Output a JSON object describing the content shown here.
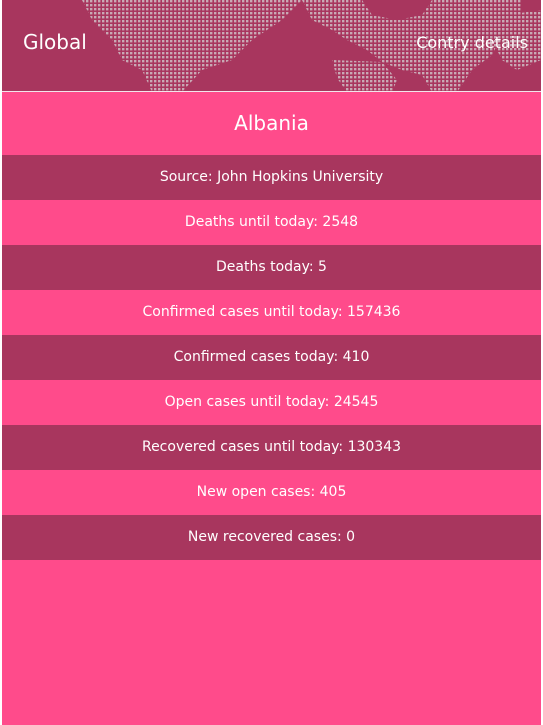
{
  "header": {
    "global_label": "Global",
    "details_label": "Contry details"
  },
  "country": {
    "name": "Albania"
  },
  "stats": [
    {
      "label": "Source: John Hopkins University"
    },
    {
      "label": "Deaths until today: 2548"
    },
    {
      "label": "Deaths today: 5"
    },
    {
      "label": "Confirmed cases until today: 157436"
    },
    {
      "label": "Confirmed cases today: 410"
    },
    {
      "label": "Open cases until today: 24545"
    },
    {
      "label": "Recovered cases until today: 130343"
    },
    {
      "label": "New open cases: 405"
    },
    {
      "label": "New recovered cases: 0"
    }
  ],
  "colors": {
    "accent": "#ff4b8b",
    "dark_row": "#a8365e",
    "text": "#ffffff"
  }
}
